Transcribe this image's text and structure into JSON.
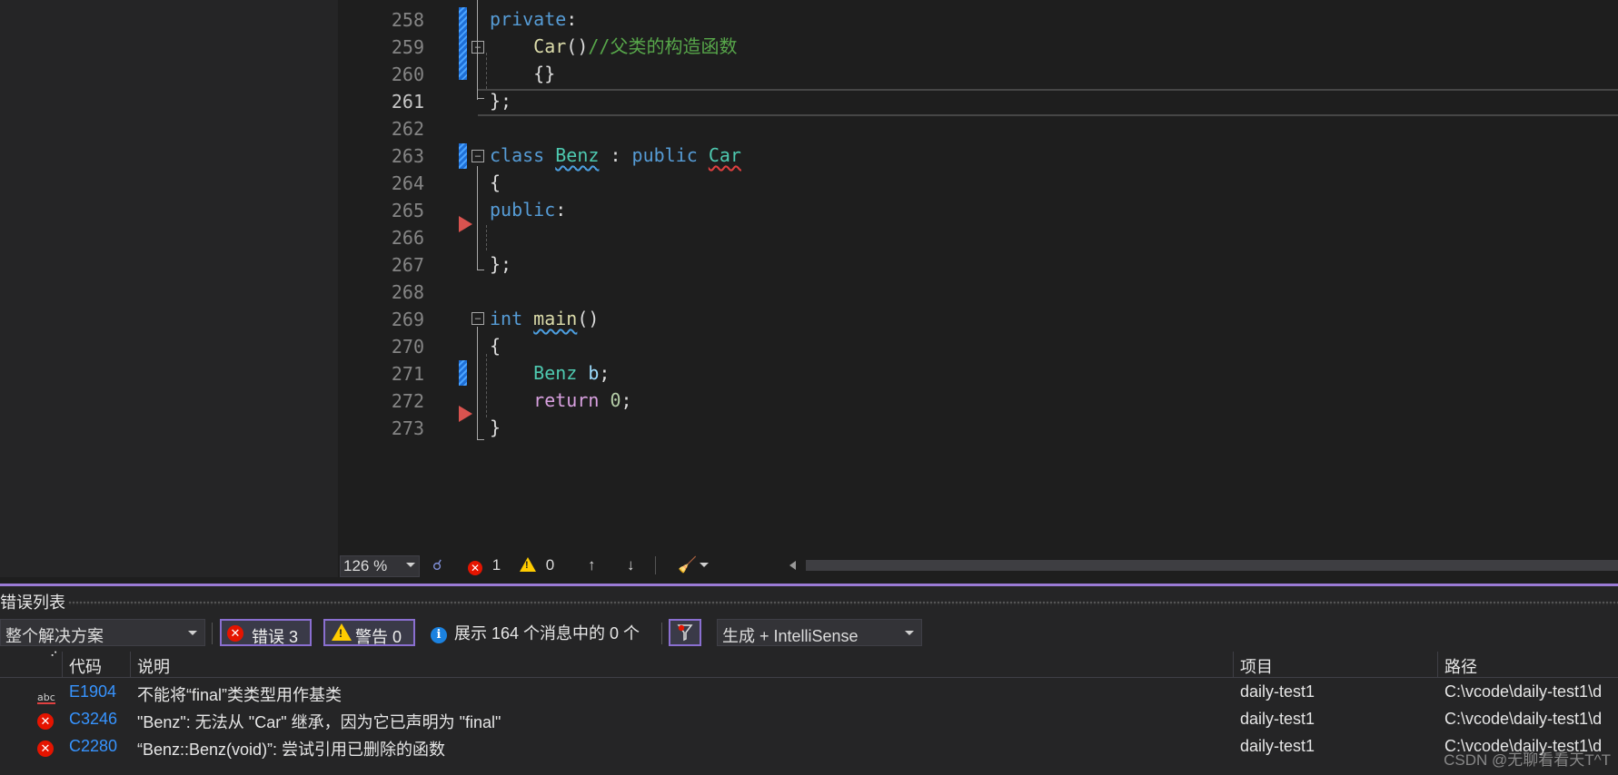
{
  "editor": {
    "lines": [
      {
        "num": "258",
        "html_parts": [
          {
            "t": "private",
            "c": "kw"
          },
          {
            "t": ":",
            "c": "pl"
          }
        ]
      },
      {
        "num": "259",
        "html_parts": [
          {
            "t": "    Car",
            "c": "fn"
          },
          {
            "t": "()",
            "c": "pl"
          },
          {
            "t": "//父类的构造函数",
            "c": "cm"
          }
        ]
      },
      {
        "num": "260",
        "html_parts": [
          {
            "t": "    {}",
            "c": "pl"
          }
        ]
      },
      {
        "num": "261",
        "html_parts": [
          {
            "t": "};",
            "c": "pl"
          }
        ]
      },
      {
        "num": "262",
        "html_parts": []
      },
      {
        "num": "263",
        "html_parts": [
          {
            "t": "class ",
            "c": "kw"
          },
          {
            "t": "Benz",
            "c": "ty squig-blue"
          },
          {
            "t": " : ",
            "c": "pl"
          },
          {
            "t": "public ",
            "c": "kw"
          },
          {
            "t": "Car",
            "c": "ty squig-red"
          }
        ]
      },
      {
        "num": "264",
        "html_parts": [
          {
            "t": "{",
            "c": "pl"
          }
        ]
      },
      {
        "num": "265",
        "html_parts": [
          {
            "t": "public",
            "c": "kw"
          },
          {
            "t": ":",
            "c": "pl"
          }
        ]
      },
      {
        "num": "266",
        "html_parts": []
      },
      {
        "num": "267",
        "html_parts": [
          {
            "t": "};",
            "c": "pl"
          }
        ]
      },
      {
        "num": "268",
        "html_parts": []
      },
      {
        "num": "269",
        "html_parts": [
          {
            "t": "int ",
            "c": "kw"
          },
          {
            "t": "main",
            "c": "fn squig-blue"
          },
          {
            "t": "()",
            "c": "pl"
          }
        ]
      },
      {
        "num": "270",
        "html_parts": [
          {
            "t": "{",
            "c": "pl"
          }
        ]
      },
      {
        "num": "271",
        "html_parts": [
          {
            "t": "    Benz ",
            "c": "ty"
          },
          {
            "t": "b",
            "c": "vr"
          },
          {
            "t": ";",
            "c": "pl"
          }
        ]
      },
      {
        "num": "272",
        "html_parts": [
          {
            "t": "    return ",
            "c": "ctl"
          },
          {
            "t": "0",
            "c": "num"
          },
          {
            "t": ";",
            "c": "pl"
          }
        ]
      },
      {
        "num": "273",
        "html_parts": [
          {
            "t": "}",
            "c": "pl"
          }
        ]
      }
    ],
    "active_line": "261"
  },
  "status": {
    "zoom": "126 %",
    "errors": "1",
    "warnings": "0"
  },
  "error_list": {
    "title": "错误列表",
    "scope": "整个解决方案",
    "errors_label": "错误 3",
    "warnings_label": "警告 0",
    "messages_label": "展示 164 个消息中的 0 个",
    "build_filter": "生成 + IntelliSense",
    "columns": {
      "code": "代码",
      "description": "说明",
      "project": "项目",
      "path": "路径"
    },
    "rows": [
      {
        "icon": "intellisense-icon",
        "code": "E1904",
        "description": "不能将“final”类类型用作基类",
        "project": "daily-test1",
        "path": "C:\\vcode\\daily-test1\\d"
      },
      {
        "icon": "error-icon",
        "code": "C3246",
        "description": "\"Benz\": 无法从 \"Car\" 继承，因为它已声明为 \"final\"",
        "project": "daily-test1",
        "path": "C:\\vcode\\daily-test1\\d"
      },
      {
        "icon": "error-icon",
        "code": "C2280",
        "description": "“Benz::Benz(void)”: 尝试引用已删除的函数",
        "project": "daily-test1",
        "path": "C:\\vcode\\daily-test1\\d"
      }
    ]
  },
  "watermark": "CSDN @无聊看看天T^T",
  "colors": {
    "accent": "#8a6fd0",
    "error": "#e51400",
    "warning": "#ffcc00",
    "info": "#1b82e0",
    "link": "#3794ff"
  }
}
